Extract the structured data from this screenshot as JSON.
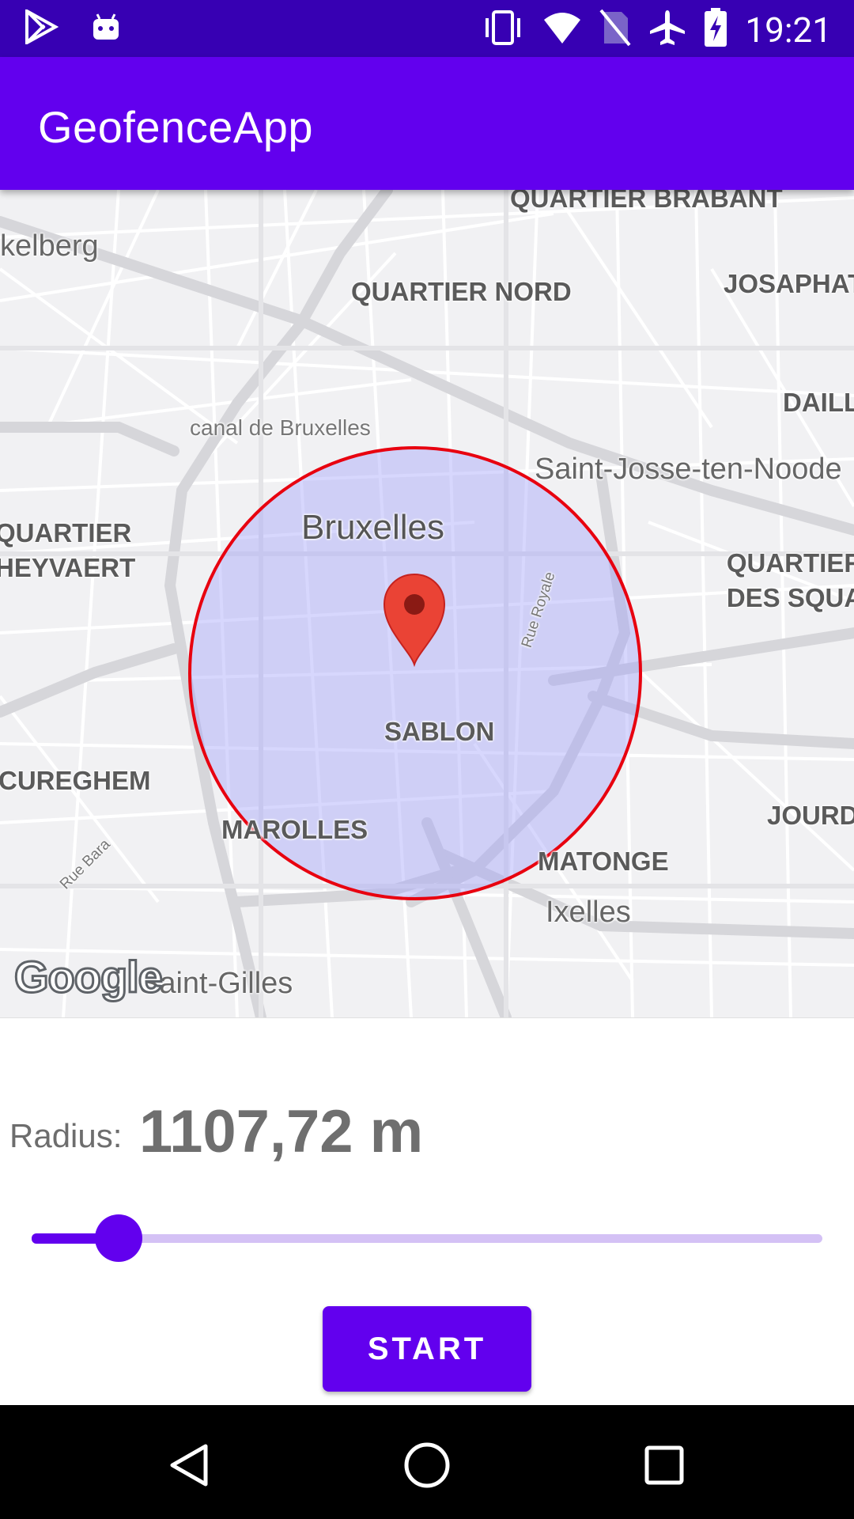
{
  "status_bar": {
    "time": "19:21",
    "left_icons": [
      "play-store-icon",
      "android-icon"
    ],
    "right_icons": [
      "vibrate-icon",
      "wifi-icon",
      "no-sim-icon",
      "airplane-icon",
      "battery-charging-icon"
    ]
  },
  "app_bar": {
    "title": "GeofenceApp"
  },
  "map": {
    "labels": {
      "kelberg": "kelberg",
      "quartier_brabant": "QUARTIER BRABANT",
      "quartier_nord": "QUARTIER NORD",
      "josaphat": "JOSAPHAT",
      "daill": "DAILL",
      "canal": "canal de Bruxelles",
      "saint_josse": "Saint-Josse-ten-Noode",
      "bruxelles": "Bruxelles",
      "quartier_heyvaert": "QUARTIER HEYVAERT",
      "quartier_des_squares": "QUARTIER DES SQUA",
      "rue_royale": "Rue Royale",
      "sablon": "SABLON",
      "cureghem": "CUREGHEM",
      "jourd": "JOURD",
      "marolles": "MAROLLES",
      "matonge": "MATONGE",
      "rue_bara": "Rue Bara",
      "ixelles": "Ixelles",
      "saint_gilles": "Saint-Gilles"
    },
    "logo": "Google",
    "geofence_color": "#E8000F",
    "geofence_fill": "#C8C8FA",
    "marker_color": "#EA4335"
  },
  "controls": {
    "radius_label": "Radius:",
    "radius_value": "1107,72 m",
    "slider_fraction": 0.11,
    "start_label": "START"
  },
  "colors": {
    "primary": "#6200EE",
    "primary_dark": "#3700B3"
  }
}
